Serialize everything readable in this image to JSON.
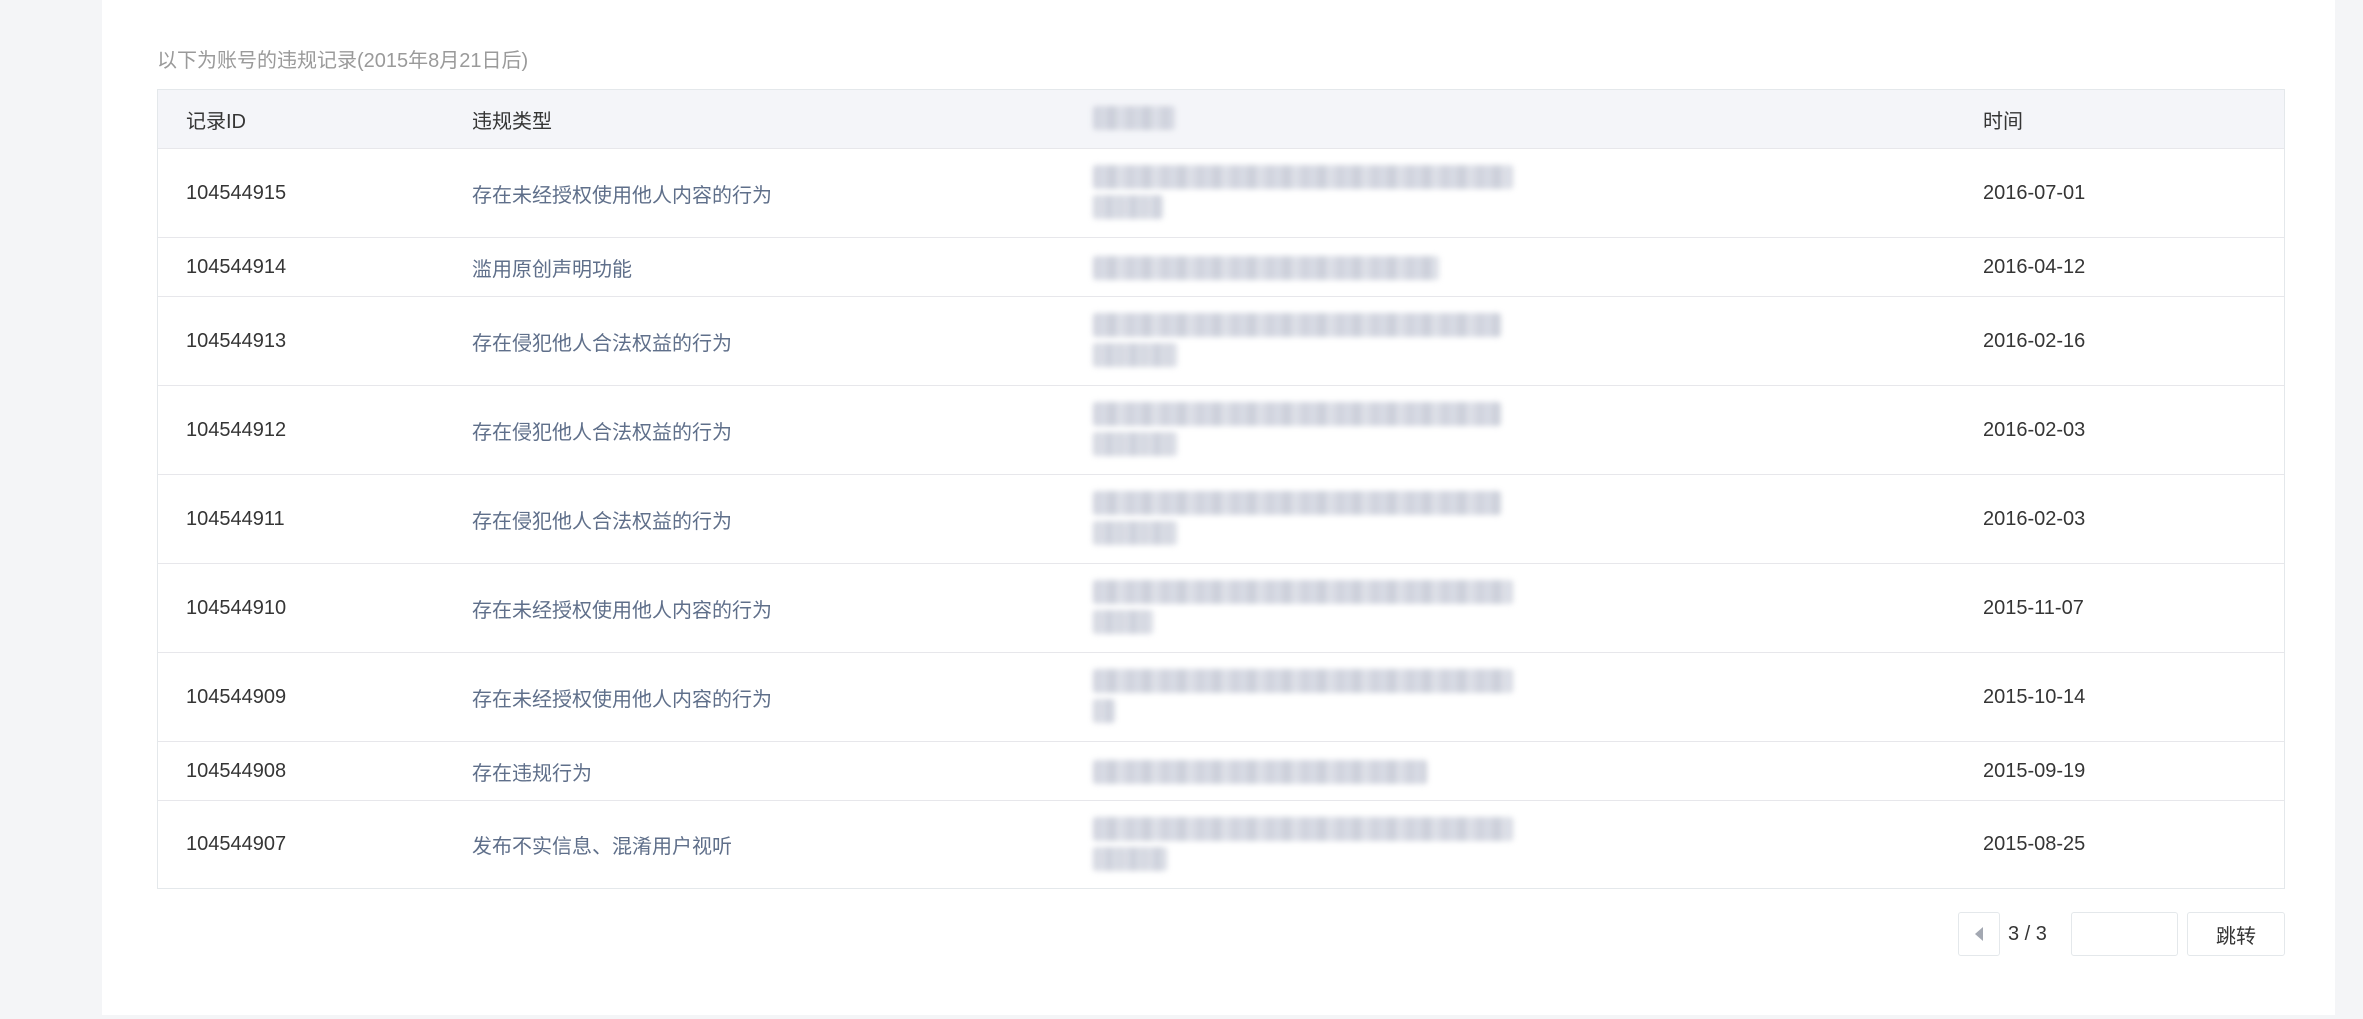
{
  "notice": "以下为账号的违规记录(2015年8月21日后)",
  "table": {
    "columns": [
      "记录ID",
      "违规类型",
      "",
      "时间"
    ],
    "rows": [
      {
        "id": "104544915",
        "type": "存在未经授权使用他人内容的行为",
        "time": "2016-07-01"
      },
      {
        "id": "104544914",
        "type": "滥用原创声明功能",
        "time": "2016-04-12"
      },
      {
        "id": "104544913",
        "type": "存在侵犯他人合法权益的行为",
        "time": "2016-02-16"
      },
      {
        "id": "104544912",
        "type": "存在侵犯他人合法权益的行为",
        "time": "2016-02-03"
      },
      {
        "id": "104544911",
        "type": "存在侵犯他人合法权益的行为",
        "time": "2016-02-03"
      },
      {
        "id": "104544910",
        "type": "存在未经授权使用他人内容的行为",
        "time": "2015-11-07"
      },
      {
        "id": "104544909",
        "type": "存在未经授权使用他人内容的行为",
        "time": "2015-10-14"
      },
      {
        "id": "104544908",
        "type": "存在违规行为",
        "time": "2015-09-19"
      },
      {
        "id": "104544907",
        "type": "发布不实信息、混淆用户视听",
        "time": "2015-08-25"
      }
    ]
  },
  "pagination": {
    "page_info": "3 / 3",
    "jump_input_value": "",
    "jump_label": "跳转",
    "prev_icon": "triangle-left-icon"
  }
}
